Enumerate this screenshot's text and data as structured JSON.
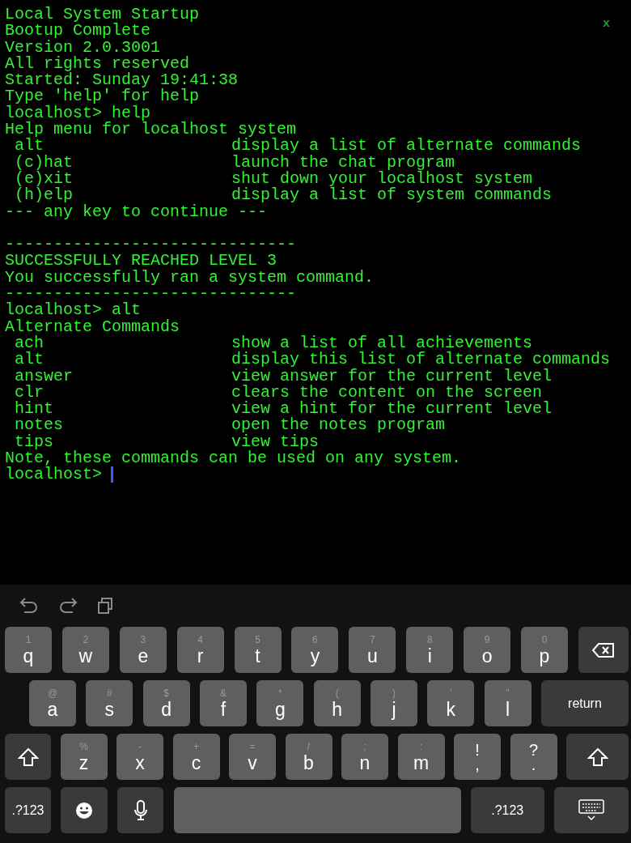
{
  "close_label": "x",
  "terminal": [
    {
      "kind": "line",
      "text": "Local System Startup"
    },
    {
      "kind": "line",
      "text": "Bootup Complete"
    },
    {
      "kind": "line",
      "text": "Version 2.0.3001"
    },
    {
      "kind": "line",
      "text": "All rights reserved"
    },
    {
      "kind": "line",
      "text": "Started: Sunday 19:41:38"
    },
    {
      "kind": "line",
      "text": "Type 'help' for help"
    },
    {
      "kind": "line",
      "text": "localhost> help"
    },
    {
      "kind": "line",
      "text": "Help menu for localhost system"
    },
    {
      "kind": "row",
      "command": "alt",
      "description": "display a list of alternate commands"
    },
    {
      "kind": "row",
      "command": "(c)hat",
      "description": "launch the chat program"
    },
    {
      "kind": "row",
      "command": "(e)xit",
      "description": "shut down your localhost system"
    },
    {
      "kind": "row",
      "command": "(h)elp",
      "description": "display a list of system commands"
    },
    {
      "kind": "line",
      "text": "--- any key to continue ---"
    },
    {
      "kind": "blank"
    },
    {
      "kind": "line",
      "text": "------------------------------"
    },
    {
      "kind": "line",
      "text": "SUCCESSFULLY REACHED LEVEL 3"
    },
    {
      "kind": "line",
      "text": "You successfully ran a system command."
    },
    {
      "kind": "line",
      "text": "------------------------------"
    },
    {
      "kind": "line",
      "text": "localhost> alt"
    },
    {
      "kind": "line",
      "text": "Alternate Commands"
    },
    {
      "kind": "row",
      "command": "ach",
      "description": "show a list of all achievements"
    },
    {
      "kind": "row",
      "command": "alt",
      "description": "display this list of alternate commands"
    },
    {
      "kind": "row",
      "command": "answer",
      "description": "view answer for the current level"
    },
    {
      "kind": "row",
      "command": "clr",
      "description": "clears the content on the screen"
    },
    {
      "kind": "row",
      "command": "hint",
      "description": "view a hint for the current level"
    },
    {
      "kind": "row",
      "command": "notes",
      "description": "open the notes program"
    },
    {
      "kind": "row",
      "command": "tips",
      "description": "view tips"
    },
    {
      "kind": "line",
      "text": "Note, these commands can be used on any system."
    },
    {
      "kind": "prompt",
      "text": "localhost>"
    }
  ],
  "keyboard": {
    "rows": [
      [
        {
          "kind": "letter",
          "main": "q",
          "alt": "1"
        },
        {
          "kind": "letter",
          "main": "w",
          "alt": "2"
        },
        {
          "kind": "letter",
          "main": "e",
          "alt": "3"
        },
        {
          "kind": "letter",
          "main": "r",
          "alt": "4"
        },
        {
          "kind": "letter",
          "main": "t",
          "alt": "5"
        },
        {
          "kind": "letter",
          "main": "y",
          "alt": "6"
        },
        {
          "kind": "letter",
          "main": "u",
          "alt": "7"
        },
        {
          "kind": "letter",
          "main": "i",
          "alt": "8"
        },
        {
          "kind": "letter",
          "main": "o",
          "alt": "9"
        },
        {
          "kind": "letter",
          "main": "p",
          "alt": "0"
        },
        {
          "kind": "backspace"
        }
      ],
      [
        {
          "kind": "letter",
          "main": "a",
          "alt": "@"
        },
        {
          "kind": "letter",
          "main": "s",
          "alt": "#"
        },
        {
          "kind": "letter",
          "main": "d",
          "alt": "$"
        },
        {
          "kind": "letter",
          "main": "f",
          "alt": "&"
        },
        {
          "kind": "letter",
          "main": "g",
          "alt": "*"
        },
        {
          "kind": "letter",
          "main": "h",
          "alt": "("
        },
        {
          "kind": "letter",
          "main": "j",
          "alt": ")"
        },
        {
          "kind": "letter",
          "main": "k",
          "alt": "'"
        },
        {
          "kind": "letter",
          "main": "l",
          "alt": "\""
        },
        {
          "kind": "return",
          "main": "return"
        }
      ],
      [
        {
          "kind": "shift"
        },
        {
          "kind": "letter",
          "main": "z",
          "alt": "%"
        },
        {
          "kind": "letter",
          "main": "x",
          "alt": "-"
        },
        {
          "kind": "letter",
          "main": "c",
          "alt": "+"
        },
        {
          "kind": "letter",
          "main": "v",
          "alt": "="
        },
        {
          "kind": "letter",
          "main": "b",
          "alt": "/"
        },
        {
          "kind": "letter",
          "main": "n",
          "alt": ";"
        },
        {
          "kind": "letter",
          "main": "m",
          "alt": ":"
        },
        {
          "kind": "punct",
          "main": ",",
          "alt": "!"
        },
        {
          "kind": "punct",
          "main": ".",
          "alt": "?"
        },
        {
          "kind": "shift_right"
        }
      ],
      [
        {
          "kind": "numbers",
          "main": ".?123"
        },
        {
          "kind": "emoji"
        },
        {
          "kind": "mic"
        },
        {
          "kind": "space"
        },
        {
          "kind": "numbers_right",
          "main": ".?123"
        },
        {
          "kind": "hide"
        }
      ]
    ]
  }
}
